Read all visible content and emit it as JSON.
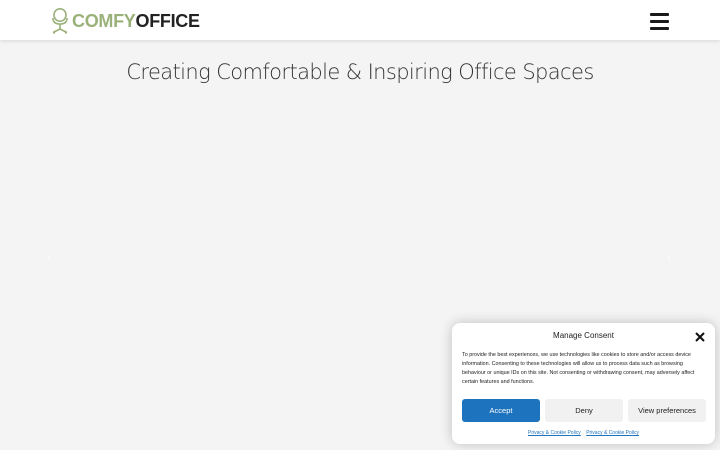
{
  "brand": {
    "logo_part1": "COMFY",
    "logo_part2": "OFFICE",
    "accent_color": "#9bb17a",
    "icon": "office-chair-icon"
  },
  "header": {
    "menu_icon": "hamburger-menu-icon"
  },
  "hero": {
    "title": "Creating Comfortable & Inspiring Office Spaces",
    "prev_arrow": "‹",
    "next_arrow": "›"
  },
  "consent": {
    "title": "Manage Consent",
    "close_icon": "close-icon",
    "text": "To provide the best experiences, we use technologies like cookies to store and/or access device information. Consenting to these technologies will allow us to process data such as browsing behaviour or unique IDs on this site. Not consenting or withdrawing consent, may adversely affect certain features and functions.",
    "accept_label": "Accept",
    "deny_label": "Deny",
    "preferences_label": "View preferences",
    "links": [
      "Privacy & Cookie Policy",
      "Privacy & Cookie Policy"
    ],
    "accept_color": "#1e73be"
  }
}
